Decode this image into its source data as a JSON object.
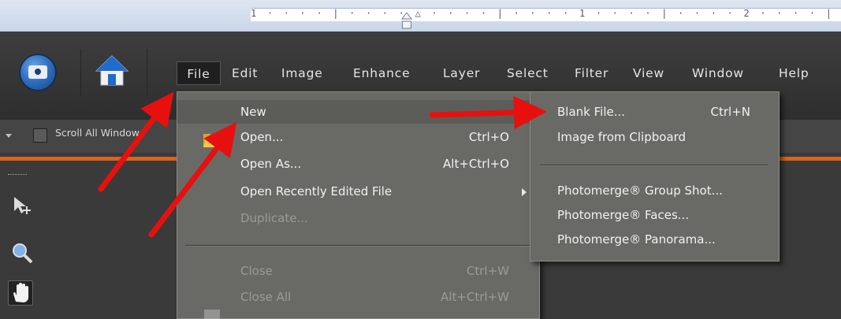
{
  "ruler": {
    "text": "1 · · · · | · · · · △ · · · · | · · · · 1 · · · · | · · · · 2 · · · · | · · ·"
  },
  "menubar": {
    "items": [
      "File",
      "Edit",
      "Image",
      "Enhance",
      "Layer",
      "Select",
      "Filter",
      "View",
      "Window",
      "Help"
    ]
  },
  "options": {
    "scroll_all_windows": "Scroll All Window"
  },
  "file_menu": {
    "items": [
      {
        "label": "New",
        "shortcut": "",
        "submenu": true,
        "enabled": true
      },
      {
        "label": "Open...",
        "shortcut": "Ctrl+O",
        "enabled": true
      },
      {
        "label": "Open As...",
        "shortcut": "Alt+Ctrl+O",
        "enabled": true
      },
      {
        "label": "Open Recently Edited File",
        "shortcut": "",
        "submenu": true,
        "enabled": true
      },
      {
        "label": "Duplicate...",
        "shortcut": "",
        "enabled": false
      },
      {
        "label": "Close",
        "shortcut": "Ctrl+W",
        "enabled": false
      },
      {
        "label": "Close All",
        "shortcut": "Alt+Ctrl+W",
        "enabled": false
      }
    ]
  },
  "new_submenu": {
    "items": [
      {
        "label": "Blank File...",
        "shortcut": "Ctrl+N"
      },
      {
        "label": "Image from Clipboard",
        "shortcut": ""
      },
      {
        "label": "Photomerge® Group Shot...",
        "shortcut": ""
      },
      {
        "label": "Photomerge® Faces...",
        "shortcut": ""
      },
      {
        "label": "Photomerge® Panorama...",
        "shortcut": ""
      }
    ]
  },
  "colors": {
    "accent_orange": "#d9641b",
    "annotation_red": "#e8100e",
    "menu_bg": "#696a66",
    "titlebar_bg": "#333333"
  },
  "icons": [
    "camera-icon",
    "home-icon",
    "folder-icon",
    "move-tool-icon",
    "zoom-tool-icon",
    "hand-tool-icon"
  ]
}
